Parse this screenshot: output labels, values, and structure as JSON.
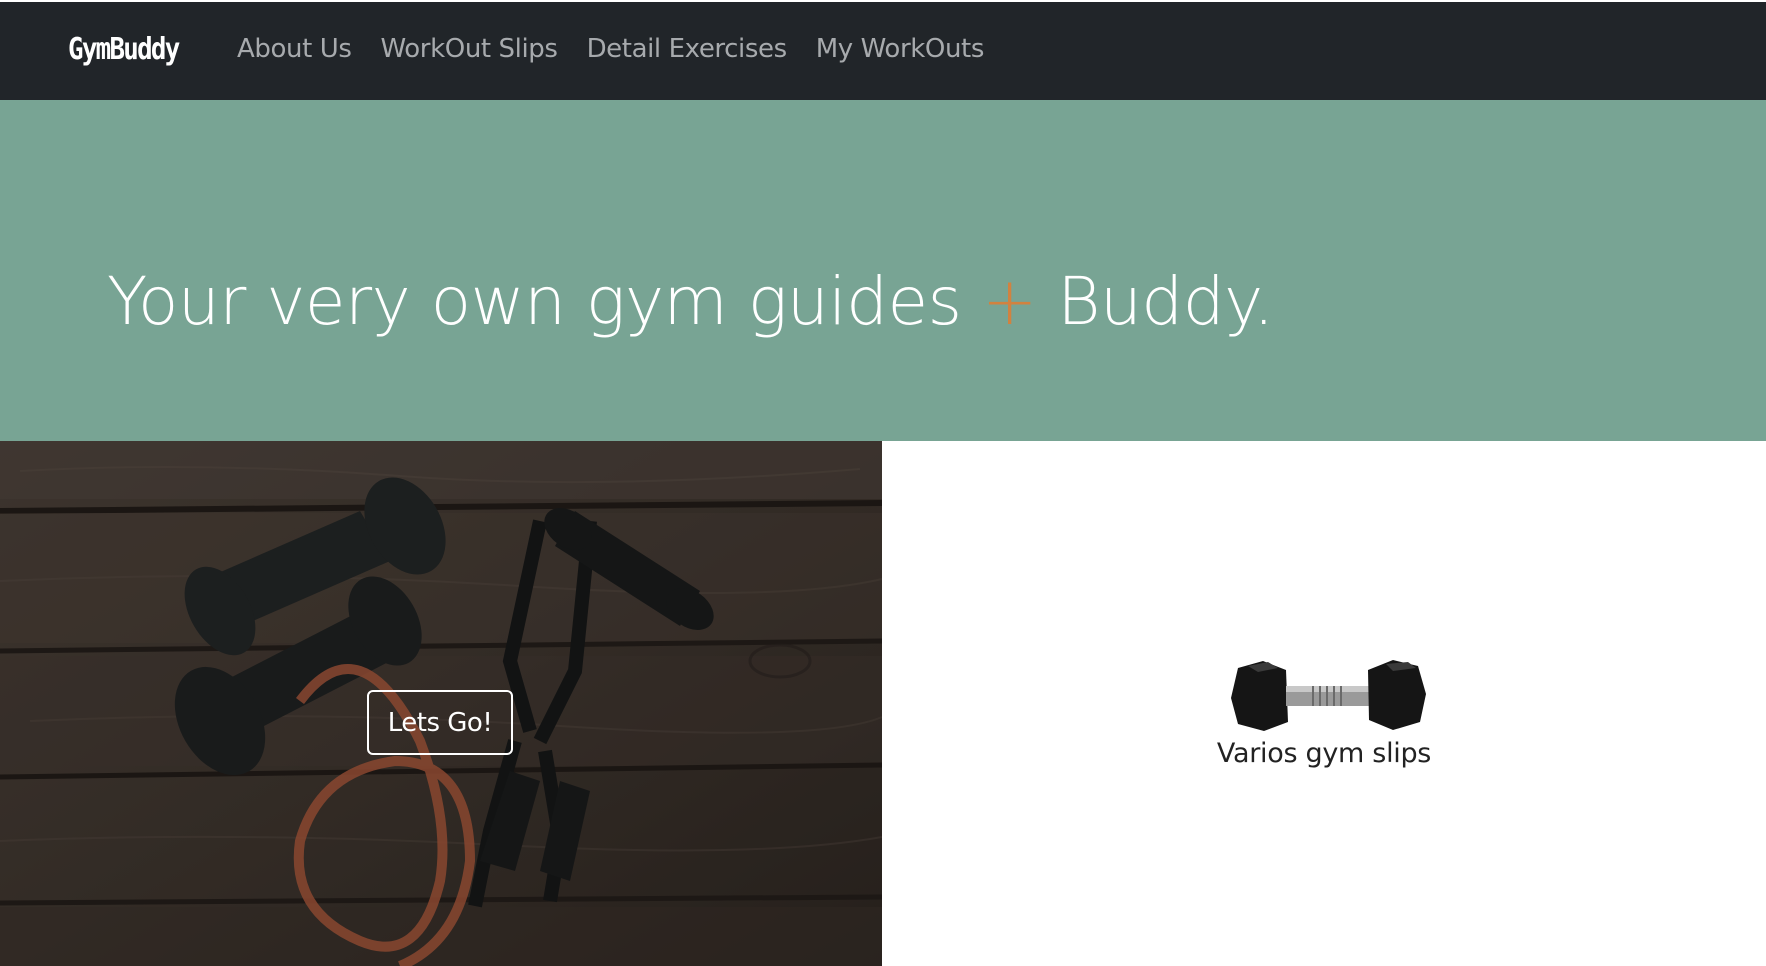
{
  "navbar": {
    "brand": "GymBuddy",
    "links": [
      "About Us",
      "WorkOut Slips",
      "Detail Exercises",
      "My WorkOuts"
    ]
  },
  "hero": {
    "title_part1": "Your very own gym guides ",
    "title_plus": "+",
    "title_part2": " Buddy."
  },
  "photo_panel": {
    "button_label": "Lets Go!"
  },
  "slips_panel": {
    "icon": "dumbbell-icon",
    "caption": "Varios gym slips"
  },
  "colors": {
    "navbar_bg": "#212529",
    "hero_bg": "#78a494",
    "accent_plus": "#d2823f",
    "nav_link": "#a7aaad"
  }
}
